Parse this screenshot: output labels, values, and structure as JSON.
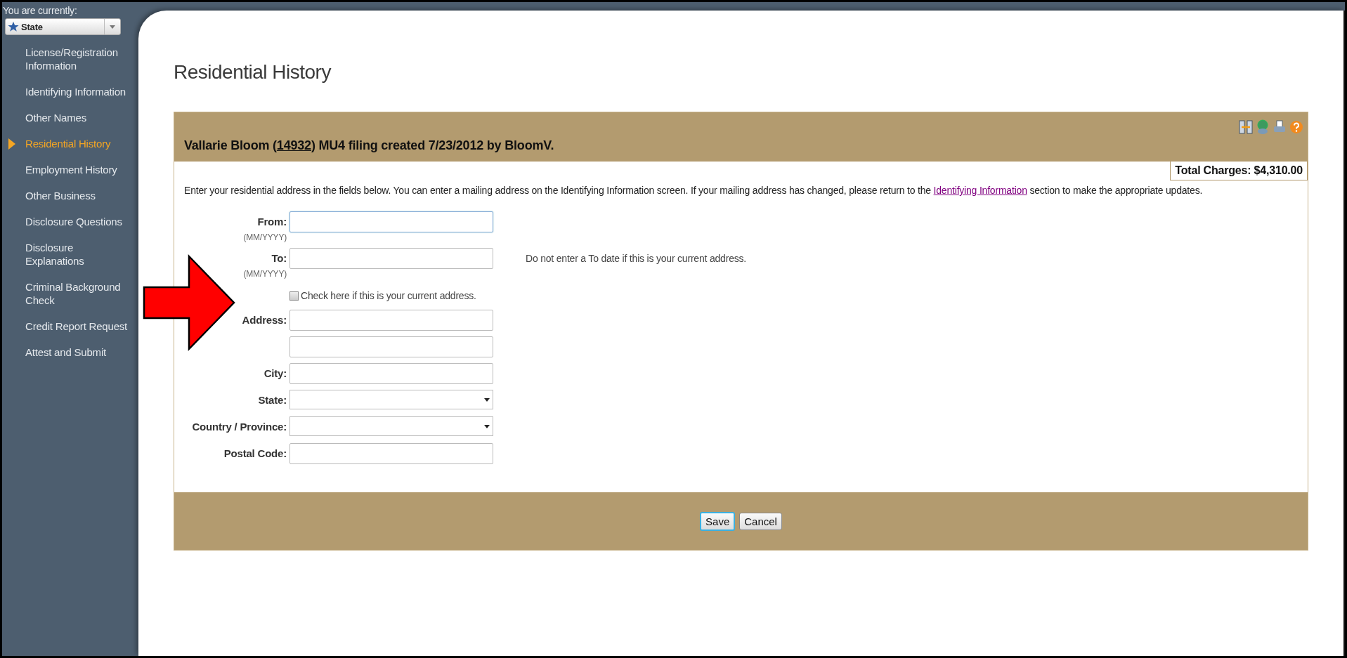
{
  "sidebar": {
    "context_label": "You are currently:",
    "context_select": {
      "value": "State"
    },
    "items": [
      {
        "label": "License/Registration Information",
        "selected": false
      },
      {
        "label": "Identifying Information",
        "selected": false
      },
      {
        "label": "Other Names",
        "selected": false
      },
      {
        "label": "Residential History",
        "selected": true
      },
      {
        "label": "Employment History",
        "selected": false
      },
      {
        "label": "Other Business",
        "selected": false
      },
      {
        "label": "Disclosure Questions",
        "selected": false
      },
      {
        "label": "Disclosure Explanations",
        "selected": false
      },
      {
        "label": "Criminal Background Check",
        "selected": false
      },
      {
        "label": "Credit Report Request",
        "selected": false
      },
      {
        "label": "Attest and Submit",
        "selected": false
      }
    ]
  },
  "page_title": "Residential History",
  "panel": {
    "header": {
      "before": "Vallarie Bloom (",
      "link": "14932",
      "after": ") MU4 filing created 7/23/2012 by BloomV."
    },
    "total_charges": "Total Charges: $4,310.00",
    "intro": {
      "before": "Enter your residential address in the fields below. You can enter a mailing address on the Identifying Information screen. If your mailing address has changed, please return to the ",
      "link": "Identifying Information",
      "after": " section to make the appropriate updates."
    },
    "fields": [
      {
        "kind": "text",
        "label": "From:",
        "hint": "(MM/YYYY)",
        "focused": true
      },
      {
        "kind": "text",
        "label": "To:",
        "hint": "(MM/YYYY)",
        "note": "Do not enter a To date if this is your current address.",
        "focused": false
      },
      {
        "kind": "checkbox",
        "text": "Check here if this is your current address.",
        "checked": false
      },
      {
        "kind": "text",
        "label": "Address:",
        "focused": false
      },
      {
        "kind": "text",
        "focused": false
      },
      {
        "kind": "text",
        "label": "City:",
        "focused": false
      },
      {
        "kind": "select",
        "label": "State:"
      },
      {
        "kind": "select",
        "label": "Country / Province:"
      },
      {
        "kind": "text",
        "label": "Postal Code:",
        "focused": false
      }
    ],
    "buttons": [
      {
        "label": "Save",
        "focused": true
      },
      {
        "label": "Cancel",
        "focused": false
      }
    ]
  }
}
